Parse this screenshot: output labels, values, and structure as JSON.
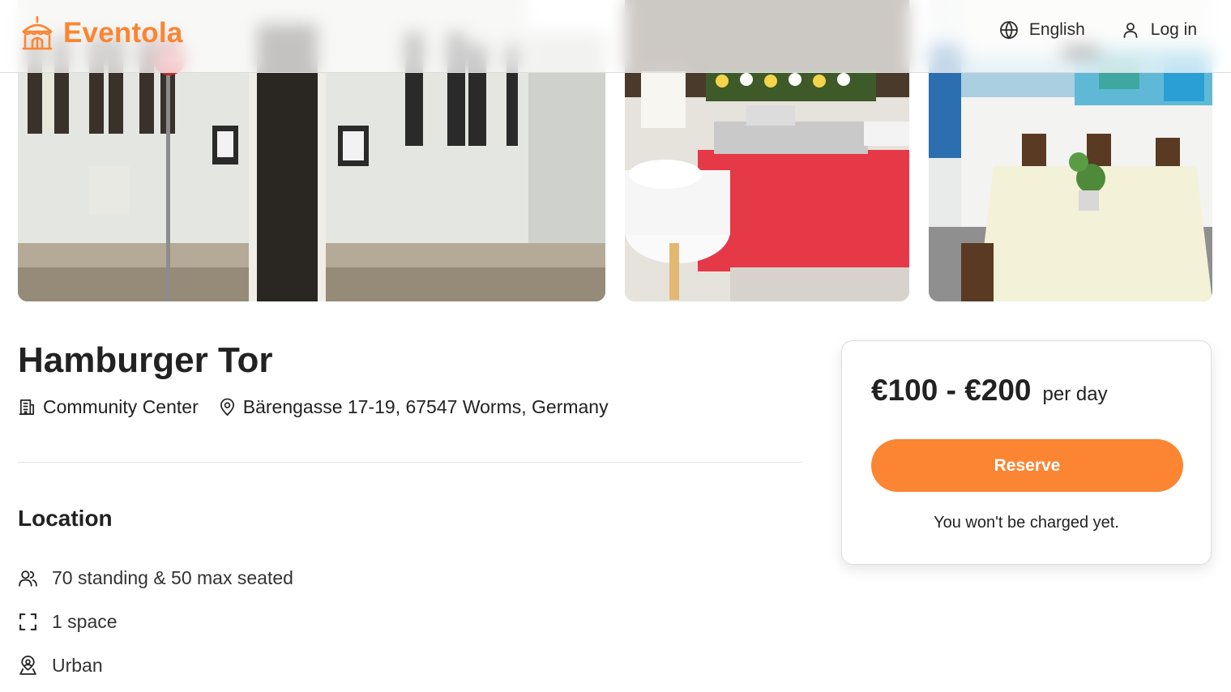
{
  "brand": {
    "name": "Eventola",
    "logo_icon": "circus-tent-icon",
    "accent_color": "#fb8532"
  },
  "nav": {
    "language": {
      "label": "English",
      "icon": "globe-icon"
    },
    "login": {
      "label": "Log in",
      "icon": "user-icon"
    }
  },
  "gallery": [
    {
      "name": "building-exterior-photo"
    },
    {
      "name": "buffet-table-photo"
    },
    {
      "name": "dining-room-photo"
    }
  ],
  "venue": {
    "title": "Hamburger Tor",
    "type": {
      "label": "Community Center",
      "icon": "building-icon"
    },
    "address": {
      "label": "Bärengasse 17-19, 67547 Worms, Germany",
      "icon": "map-pin-icon"
    }
  },
  "location": {
    "heading": "Location",
    "features": [
      {
        "label": "70 standing & 50 max seated",
        "icon": "users-icon"
      },
      {
        "label": "1 space",
        "icon": "expand-frame-icon"
      },
      {
        "label": "Urban",
        "icon": "location-person-icon"
      }
    ]
  },
  "booking": {
    "price_range": "€100 - €200",
    "price_unit": "per day",
    "reserve_label": "Reserve",
    "note": "You won't be charged yet."
  }
}
